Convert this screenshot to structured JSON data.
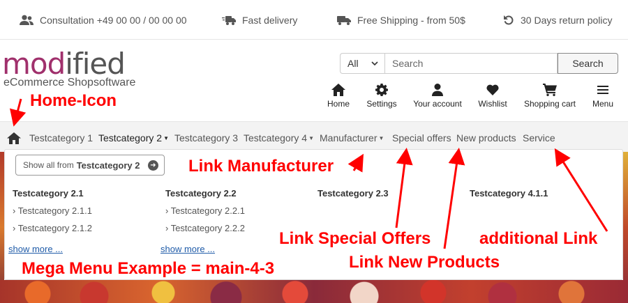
{
  "topbar": {
    "consultation": "Consultation +49 00 00 / 00 00 00",
    "fast_delivery": "Fast delivery",
    "free_shipping": "Free Shipping - from 50$",
    "return_policy": "30 Days return policy"
  },
  "logo": {
    "part1": "mod",
    "part2": "ified",
    "subtitle": "eCommerce Shopsoftware"
  },
  "search": {
    "category": "All",
    "placeholder": "Search",
    "button": "Search"
  },
  "header_icons": {
    "home": "Home",
    "settings": "Settings",
    "account": "Your account",
    "wishlist": "Wishlist",
    "cart": "Shopping cart",
    "menu": "Menu"
  },
  "nav": {
    "items": [
      "Testcategory 1",
      "Testcategory 2",
      "Testcategory 3",
      "Testcategory 4",
      "Manufacturer",
      "Special offers",
      "New products",
      "Service"
    ]
  },
  "mega": {
    "show_all_prefix": "Show all from",
    "show_all_category": "Testcategory 2",
    "columns": [
      {
        "title": "Testcategory 2.1",
        "links": [
          "› Testcategory 2.1.1",
          "› Testcategory 2.1.2"
        ],
        "more": "show more ..."
      },
      {
        "title": "Testcategory 2.2",
        "links": [
          "› Testcategory 2.2.1",
          "› Testcategory 2.2.2"
        ],
        "more": "show more ..."
      },
      {
        "title": "Testcategory 2.3",
        "links": []
      },
      {
        "title": "Testcategory 4.1.1",
        "links": []
      }
    ]
  },
  "annotations": {
    "home_icon": "Home-Icon",
    "link_manufacturer": "Link Manufacturer",
    "link_special_offers": "Link Special Offers",
    "additional_link": "additional Link",
    "link_new_products": "Link New Products",
    "mega_menu_example": "Mega Menu Example = main-4-3"
  },
  "colors": {
    "annotation": "#ff0000",
    "logo_accent": "#a0306c",
    "link": "#1f5ba8"
  }
}
